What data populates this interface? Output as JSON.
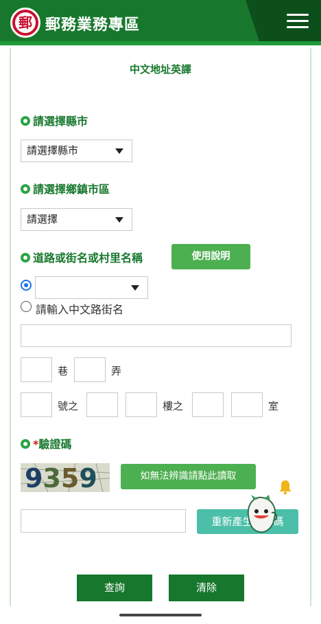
{
  "header": {
    "logo_glyph": "郵",
    "title": "郵務業務專區"
  },
  "page": {
    "title": "中文地址英譯"
  },
  "county": {
    "label": "請選擇縣市",
    "selected": "請選擇縣市"
  },
  "township": {
    "label": "請選擇鄉鎮市區",
    "selected": "請選擇"
  },
  "road": {
    "label": "道路或街名或村里名稱",
    "help_button": "使用說明",
    "select_value": "",
    "manual_option": "請輸入中文路街名",
    "manual_input_value": ""
  },
  "address_units": {
    "lane": "巷",
    "alley": "弄",
    "number_of": "號之",
    "floor_of": "樓之",
    "room": "室"
  },
  "captcha": {
    "label": "驗證碼",
    "required_mark": "*",
    "digits": [
      "9",
      "3",
      "5",
      "9"
    ],
    "audio_button": "如無法辨識請點此讀取",
    "regenerate_button": "重新產生驗證碼",
    "input_value": ""
  },
  "actions": {
    "query": "查詢",
    "clear": "清除"
  },
  "colors": {
    "header_green": "#17782d",
    "accent_green": "#4caf50",
    "teal": "#4bbfa8",
    "required_red": "#d01b1b"
  }
}
